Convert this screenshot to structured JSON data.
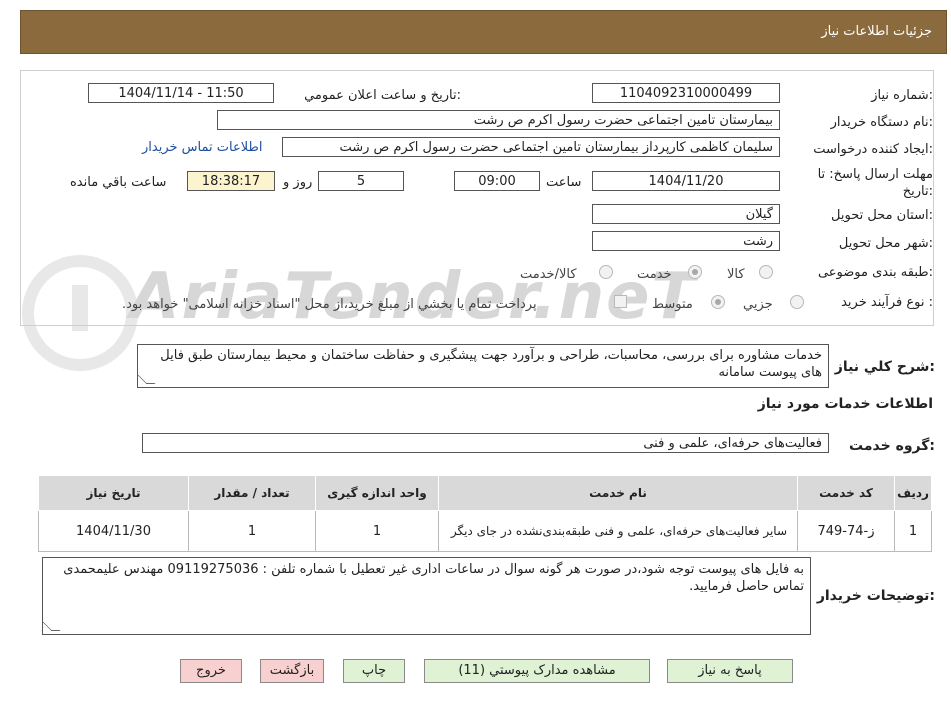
{
  "header": {
    "title": "جزئیات اطلاعات نیاز"
  },
  "need_number": {
    "label": "شماره نیاز:",
    "value": "1104092310000499"
  },
  "announce": {
    "label": "تاریخ و ساعت اعلان عمومي:",
    "value": "1404/11/14 - 11:50"
  },
  "buyer_org": {
    "label": "نام دستگاه خريدار:",
    "value": "بیمارستان  تامین اجتماعی حضرت رسول اکرم ص رشت"
  },
  "requester": {
    "label": "ايجاد کننده درخواست:",
    "value": "سلیمان کاظمی کارپرداز بیمارستان  تامین اجتماعی حضرت رسول اکرم ص رشت",
    "contact_link": "اطلاعات تماس خريدار"
  },
  "deadline": {
    "label_line1": "مهلت ارسال پاسخ: تا",
    "label_line2": "تاريخ:",
    "date": "1404/11/20",
    "time_label": "ساعت",
    "time": "09:00",
    "days": "5",
    "days_label": "روز و",
    "remaining": "18:38:17",
    "remaining_label": "ساعت باقي مانده"
  },
  "province": {
    "label": "استان محل تحويل:",
    "value": "گیلان"
  },
  "city": {
    "label": "شهر محل تحويل:",
    "value": "رشت"
  },
  "category": {
    "label": "طبقه بندی موضوعی:",
    "options": [
      "کالا",
      "خدمت",
      "کالا/خدمت"
    ],
    "selected": "خدمت"
  },
  "process": {
    "label": "نوع فرآيند خريد :",
    "options": [
      "جزيي",
      "متوسط"
    ],
    "selected": "متوسط",
    "payment_note": "پرداخت تمام يا بخشي از مبلغ خريد،از محل \"اسناد خزانه اسلامی\" خواهد بود."
  },
  "description": {
    "label": "شرح کلي نياز:",
    "value": "خدمات مشاوره برای بررسی، محاسبات، طراحی و برآورد جهت پیشگیری و حفاظت ساختمان و محیط بیمارستان طبق فایل های پیوست سامانه"
  },
  "services_title": "اطلاعات خدمات مورد نياز",
  "service_group": {
    "label": "گروه خدمت:",
    "value": "فعالیت‌های حرفه‌ای، علمی و فنی"
  },
  "table": {
    "headers": [
      "رديف",
      "کد خدمت",
      "نام خدمت",
      "واحد اندازه گيری",
      "تعداد / مقدار",
      "تاريخ نياز"
    ],
    "rows": [
      {
        "index": "1",
        "code": "ز-74-749",
        "name": "سایر فعالیت‌های حرفه‌ای، علمی و فنی طبقه‌بندی‌نشده در جای دیگر",
        "unit": "1",
        "qty": "1",
        "date": "1404/11/30"
      }
    ]
  },
  "buyer_notes": {
    "label": "توضيحات خريدار:",
    "value": "به فایل های پیوست توجه شود،در صورت هر گونه سوال در ساعات اداری غیر تعطیل با شماره تلفن : 09119275036 مهندس علیمحمدی تماس حاصل فرمایید."
  },
  "buttons": {
    "reply": "پاسخ به نياز",
    "attachments": "مشاهده مدارک پيوستي (11)",
    "print": "چاپ",
    "back": "بازگشت",
    "exit": "خروج"
  },
  "watermark": {
    "text": "AriaTender.neT"
  },
  "colors": {
    "header_bg": "#8b6a3e",
    "green_button": "#dff2d4",
    "pink_button": "#f8d0d0",
    "remaining_bg": "#fcf4cf",
    "link": "#1d4fa0"
  }
}
